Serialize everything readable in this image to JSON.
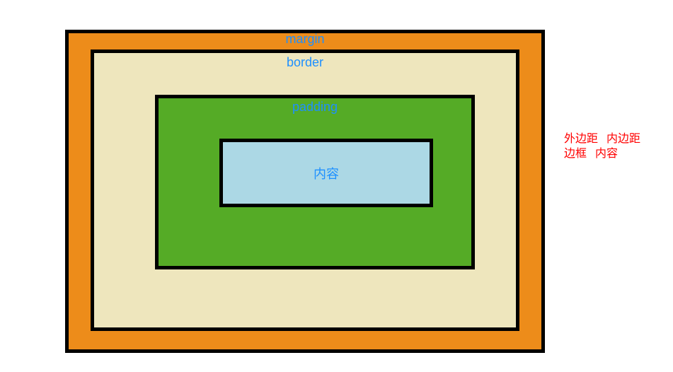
{
  "boxmodel": {
    "margin_label": "margin",
    "border_label": "border",
    "padding_label": "padding",
    "content_label": "内容"
  },
  "side": {
    "line1_a": "外边距",
    "line1_b": "内边距",
    "line2_a": "边框",
    "line2_b": "内容"
  },
  "colors": {
    "margin": "#ED8C1A",
    "border": "#EEE6BD",
    "padding": "#55AB26",
    "content": "#ACD8E5",
    "label": "#1E90FF",
    "side_text": "#FF0000",
    "outline": "#000000"
  }
}
